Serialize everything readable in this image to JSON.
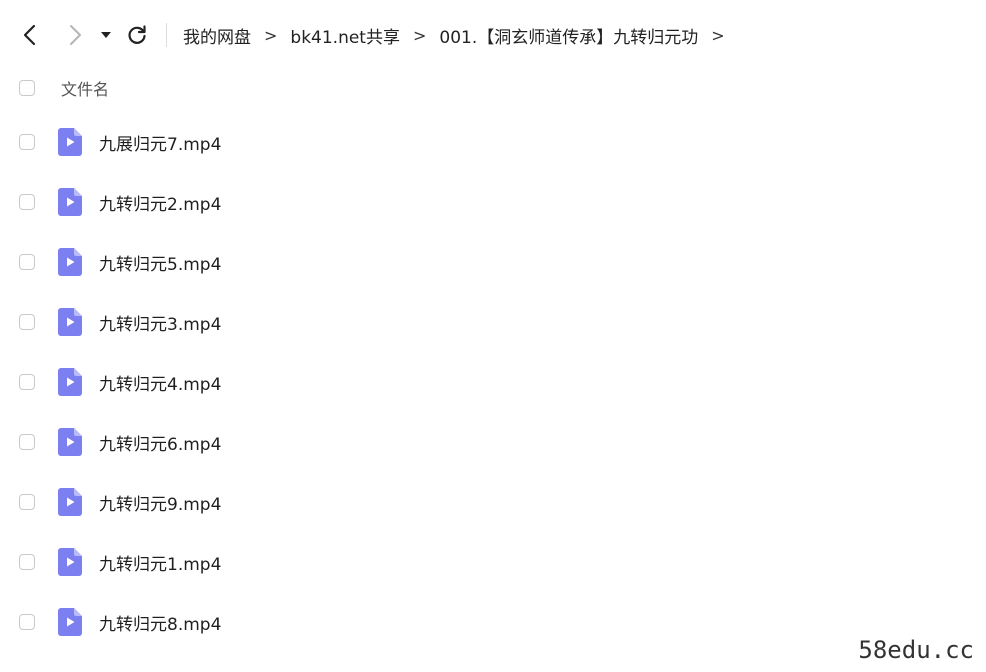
{
  "toolbar": {
    "back_icon": "chevron-left-icon",
    "forward_icon": "chevron-right-icon",
    "history_icon": "caret-down-icon",
    "refresh_icon": "refresh-icon"
  },
  "breadcrumb": {
    "items": [
      "我的网盘",
      "bk41.net共享",
      "001.【洞玄师道传承】九转归元功"
    ],
    "separator": ">"
  },
  "list_header": {
    "name_column": "文件名"
  },
  "files": [
    {
      "name": "九展归元7.mp4",
      "icon": "video-file-icon"
    },
    {
      "name": "九转归元2.mp4",
      "icon": "video-file-icon"
    },
    {
      "name": "九转归元5.mp4",
      "icon": "video-file-icon"
    },
    {
      "name": "九转归元3.mp4",
      "icon": "video-file-icon"
    },
    {
      "name": "九转归元4.mp4",
      "icon": "video-file-icon"
    },
    {
      "name": "九转归元6.mp4",
      "icon": "video-file-icon"
    },
    {
      "name": "九转归元9.mp4",
      "icon": "video-file-icon"
    },
    {
      "name": "九转归元1.mp4",
      "icon": "video-file-icon"
    },
    {
      "name": "九转归元8.mp4",
      "icon": "video-file-icon"
    }
  ],
  "colors": {
    "file_icon": "#7b7ff0",
    "file_icon_fold": "#b9bbf8",
    "checkbox_border": "#c9c9c9"
  },
  "watermark": "58edu.cc"
}
